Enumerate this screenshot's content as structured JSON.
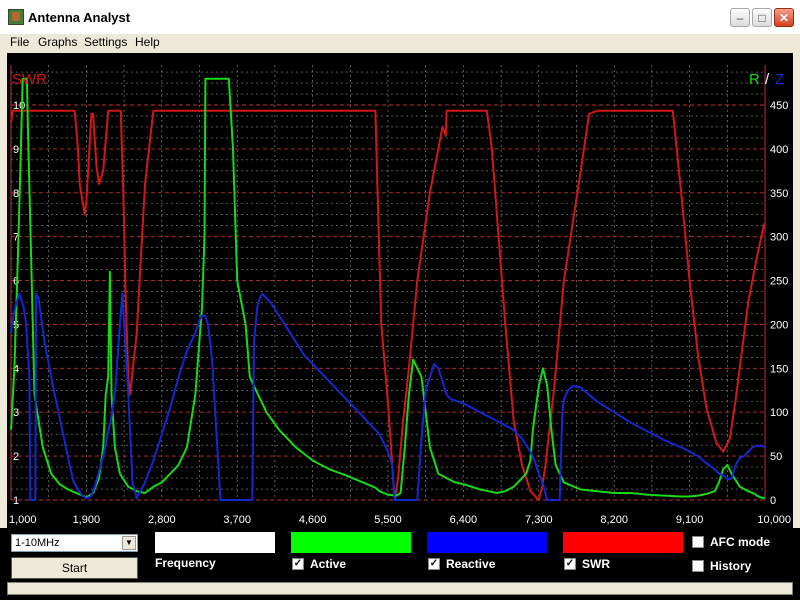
{
  "window": {
    "title": "Antenna Analyst",
    "min_glyph": "–",
    "max_glyph": "□",
    "close_glyph": "✕"
  },
  "menu": {
    "items": [
      "File",
      "Graphs",
      "Settings",
      "Help"
    ]
  },
  "controls": {
    "band_value": "1-10MHz",
    "start_label": "Start",
    "frequency_label": "Frequency",
    "active_label": "Active",
    "reactive_label": "Reactive",
    "swr_label": "SWR",
    "afc_label": "AFC mode",
    "history_label": "History",
    "check_glyph": "✓",
    "active_checked": true,
    "reactive_checked": true,
    "swr_checked": true,
    "afc_checked": false,
    "history_checked": false,
    "frequency_color": "#ffffff",
    "active_color": "#00ff00",
    "reactive_color": "#0000ff",
    "swr_color": "#ff0000"
  },
  "chart_data": {
    "type": "line",
    "left_axis_title": "SWR",
    "right_axis_title_r": "R",
    "right_axis_title_sep": "/",
    "right_axis_title_z": "Z",
    "x_ticks": [
      "1,000",
      "1,900",
      "2,800",
      "3,700",
      "4,600",
      "5,500",
      "6,400",
      "7,300",
      "8,200",
      "9,100",
      "10,000"
    ],
    "xlim": [
      1000,
      10000
    ],
    "left_ylim": [
      1,
      10
    ],
    "left_ticks": [
      "1",
      "2",
      "3",
      "4",
      "5",
      "6",
      "7",
      "8",
      "9",
      "10"
    ],
    "right_ylim": [
      0,
      450
    ],
    "right_ticks": [
      "0",
      "50",
      "100",
      "150",
      "200",
      "250",
      "300",
      "350",
      "400",
      "450"
    ],
    "grid": true,
    "background": "#000000",
    "series": [
      {
        "name": "SWR",
        "color": "#d01818",
        "axis": "left",
        "x": [
          1000,
          1020,
          1100,
          1200,
          1400,
          1600,
          1700,
          1760,
          1800,
          1820,
          1880,
          1900,
          1960,
          1980,
          2020,
          2050,
          2100,
          2160,
          2200,
          2260,
          2310,
          2340,
          2370,
          2400,
          2420,
          2500,
          2600,
          2700,
          2800,
          3000,
          3500,
          4000,
          4500,
          5000,
          5350,
          5390,
          5420,
          5500,
          5580,
          5620,
          5680,
          5750,
          5850,
          6000,
          6150,
          6190,
          6200,
          6230,
          6300,
          6600,
          6680,
          6740,
          6800,
          6900,
          7000,
          7100,
          7200,
          7300,
          7340,
          7380,
          7480,
          7600,
          7800,
          7900,
          8000,
          8400,
          8800,
          8900,
          9000,
          9100,
          9200,
          9300,
          9420,
          9500,
          9580,
          9650,
          9800,
          9900,
          9990
        ],
        "y": [
          9.6,
          9.87,
          9.87,
          9.87,
          9.87,
          9.87,
          9.87,
          9.87,
          9.0,
          8.2,
          7.5,
          7.8,
          9.8,
          9.8,
          8.6,
          8.2,
          8.5,
          9.87,
          9.87,
          9.87,
          9.87,
          8.0,
          5.5,
          3.8,
          3.4,
          4.8,
          8.2,
          9.87,
          9.87,
          9.87,
          9.87,
          9.87,
          9.87,
          9.87,
          9.87,
          7.0,
          5.0,
          3.2,
          1.0,
          1.5,
          2.8,
          4.0,
          6.0,
          8.0,
          9.5,
          9.3,
          9.87,
          9.87,
          9.87,
          9.87,
          9.87,
          9.0,
          7.5,
          5.0,
          2.8,
          1.8,
          1.2,
          1.0,
          1.3,
          1.8,
          3.5,
          6.0,
          8.5,
          9.8,
          9.87,
          9.87,
          9.87,
          9.87,
          8.0,
          6.0,
          4.3,
          3.1,
          2.3,
          2.1,
          2.4,
          3.3,
          5.5,
          6.5,
          7.3
        ]
      },
      {
        "name": "R",
        "color": "#18d818",
        "axis": "right",
        "x": [
          1000,
          1040,
          1080,
          1110,
          1140,
          1160,
          1170,
          1190,
          1200,
          1280,
          1380,
          1480,
          1580,
          1680,
          1780,
          1850,
          1900,
          1980,
          2050,
          2100,
          2130,
          2160,
          2180,
          2200,
          2240,
          2300,
          2400,
          2500,
          2600,
          2700,
          2800,
          2900,
          3000,
          3100,
          3200,
          3280,
          3310,
          3320,
          3340,
          3500,
          3580,
          3600,
          3650,
          3700,
          3800,
          3850,
          3950,
          4050,
          4200,
          4400,
          4600,
          4800,
          5000,
          5200,
          5350,
          5400,
          5450,
          5500,
          5600,
          5650,
          5700,
          5750,
          5800,
          5900,
          6000,
          6100,
          6200,
          6300,
          6400,
          6500,
          6600,
          6700,
          6800,
          6900,
          7000,
          7100,
          7150,
          7200,
          7230,
          7300,
          7350,
          7400,
          7450,
          7500,
          7600,
          7800,
          8000,
          8200,
          8400,
          8600,
          8800,
          9000,
          9100,
          9200,
          9300,
          9400,
          9450,
          9500,
          9550,
          9600,
          9700,
          9800,
          9880,
          9900,
          9950,
          10000
        ],
        "y": [
          80,
          150,
          270,
          370,
          480,
          480,
          480,
          480,
          430,
          120,
          60,
          30,
          18,
          12,
          8,
          5,
          3,
          8,
          25,
          60,
          120,
          140,
          260,
          120,
          60,
          30,
          15,
          10,
          8,
          15,
          20,
          30,
          40,
          60,
          120,
          220,
          300,
          480,
          480,
          480,
          480,
          480,
          400,
          250,
          200,
          140,
          120,
          100,
          80,
          60,
          45,
          35,
          28,
          20,
          14,
          10,
          8,
          6,
          5,
          8,
          60,
          120,
          160,
          140,
          60,
          30,
          25,
          20,
          18,
          15,
          12,
          10,
          8,
          10,
          15,
          25,
          30,
          45,
          80,
          130,
          150,
          130,
          80,
          40,
          20,
          12,
          10,
          8,
          8,
          6,
          5,
          4,
          4,
          5,
          7,
          10,
          20,
          35,
          40,
          30,
          15,
          10,
          7,
          5,
          3,
          2
        ]
      },
      {
        "name": "Z",
        "color": "#1428d0",
        "axis": "right",
        "x": [
          1000,
          1010,
          1050,
          1100,
          1150,
          1180,
          1220,
          1230,
          1260,
          1290,
          1300,
          1330,
          1400,
          1500,
          1600,
          1700,
          1750,
          1800,
          1850,
          1900,
          1950,
          2000,
          2100,
          2200,
          2250,
          2270,
          2300,
          2330,
          2400,
          2450,
          2500,
          2600,
          2700,
          2800,
          2900,
          3000,
          3100,
          3200,
          3250,
          3280,
          3300,
          3320,
          3350,
          3400,
          3500,
          3600,
          3700,
          3800,
          3850,
          3880,
          3900,
          3920,
          3940,
          3970,
          4000,
          4100,
          4200,
          4300,
          4400,
          4500,
          4600,
          4700,
          4800,
          4900,
          5000,
          5100,
          5200,
          5300,
          5400,
          5500,
          5550,
          5580,
          5600,
          5650,
          5700,
          5750,
          5780,
          5800,
          5850,
          5900,
          5950,
          6000,
          6050,
          6100,
          6150,
          6200,
          6250,
          6400,
          6600,
          6800,
          7000,
          7100,
          7200,
          7250,
          7300,
          7350,
          7400,
          7450,
          7500,
          7520,
          7540,
          7550,
          7580,
          7600,
          7650,
          7700,
          7800,
          7900,
          8000,
          8200,
          8400,
          8600,
          8800,
          9000,
          9200,
          9300,
          9400,
          9450,
          9500,
          9550,
          9600,
          9650,
          9700,
          9750,
          9800,
          9850,
          9900,
          9950,
          10000
        ],
        "y": [
          190,
          200,
          220,
          235,
          220,
          200,
          140,
          0,
          0,
          0,
          235,
          230,
          180,
          130,
          85,
          40,
          20,
          12,
          5,
          2,
          4,
          15,
          50,
          95,
          130,
          160,
          200,
          235,
          120,
          20,
          2,
          20,
          45,
          75,
          105,
          140,
          170,
          190,
          205,
          210,
          210,
          210,
          200,
          160,
          0,
          0,
          0,
          0,
          0,
          0,
          180,
          200,
          220,
          230,
          235,
          225,
          210,
          195,
          180,
          165,
          155,
          145,
          135,
          125,
          115,
          105,
          95,
          85,
          75,
          55,
          40,
          0,
          0,
          0,
          0,
          0,
          0,
          0,
          0,
          70,
          125,
          140,
          155,
          150,
          135,
          120,
          115,
          110,
          100,
          90,
          80,
          70,
          55,
          45,
          30,
          18,
          0,
          0,
          0,
          0,
          0,
          0,
          100,
          115,
          125,
          130,
          128,
          120,
          112,
          100,
          88,
          78,
          68,
          60,
          50,
          42,
          35,
          30,
          28,
          24,
          24,
          40,
          48,
          50,
          55,
          60,
          62,
          62,
          60
        ],
        "note": "ignore"
      }
    ]
  }
}
